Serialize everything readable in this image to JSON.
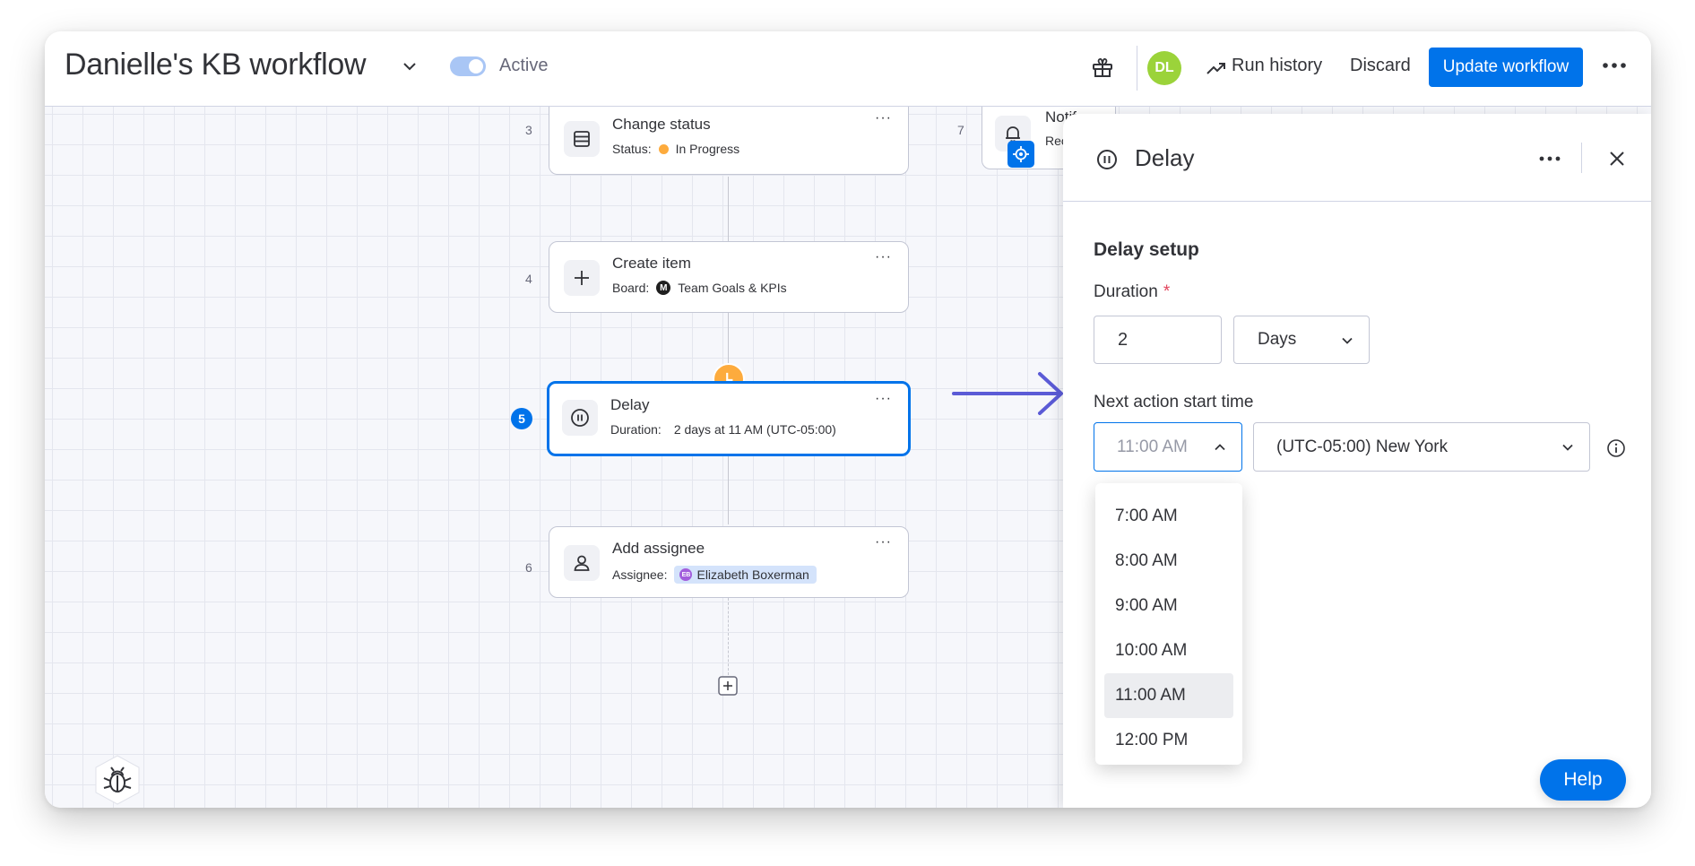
{
  "header": {
    "title": "Danielle's KB workflow",
    "toggle_label": "Active",
    "avatar_initials": "DL",
    "run_history": "Run history",
    "discard": "Discard",
    "update_workflow": "Update workflow"
  },
  "canvas": {
    "nodes": [
      {
        "number": "3",
        "title": "Change status",
        "sub_label": "Status:",
        "sub_value": "In Progress",
        "icon": "table-icon"
      },
      {
        "number": "4",
        "title": "Create item",
        "sub_label": "Board:",
        "sub_value": "Team Goals & KPIs",
        "board_logo": "M",
        "icon": "plus-icon"
      },
      {
        "number": "5",
        "title": "Delay",
        "sub_label": "Duration:",
        "sub_value": "2 days at 11 AM (UTC-05:00)",
        "icon": "pause-icon"
      },
      {
        "number": "6",
        "title": "Add assignee",
        "sub_label": "Assignee:",
        "sub_value": "Elizabeth Boxerman",
        "assignee_initials": "EB",
        "icon": "person-icon"
      }
    ],
    "partial_node": {
      "number": "7",
      "title": "Notif",
      "sub": "Rec",
      "icon": "bell-icon"
    },
    "more_glyph": "···"
  },
  "panel": {
    "title": "Delay",
    "section_heading": "Delay setup",
    "duration_label": "Duration",
    "required_mark": "*",
    "duration_value": "2",
    "duration_unit": "Days",
    "next_action_label": "Next action start time",
    "time_value": "11:00 AM",
    "timezone": "(UTC-05:00) New York",
    "time_options": [
      "7:00 AM",
      "8:00 AM",
      "9:00 AM",
      "10:00 AM",
      "11:00 AM",
      "12:00 PM"
    ],
    "selected_time": "11:00 AM",
    "help": "Help"
  },
  "colors": {
    "primary": "#0073ea",
    "status_in_progress": "#fdab3d",
    "avatar": "#9bd33a",
    "arrow": "#5b5bd6"
  }
}
